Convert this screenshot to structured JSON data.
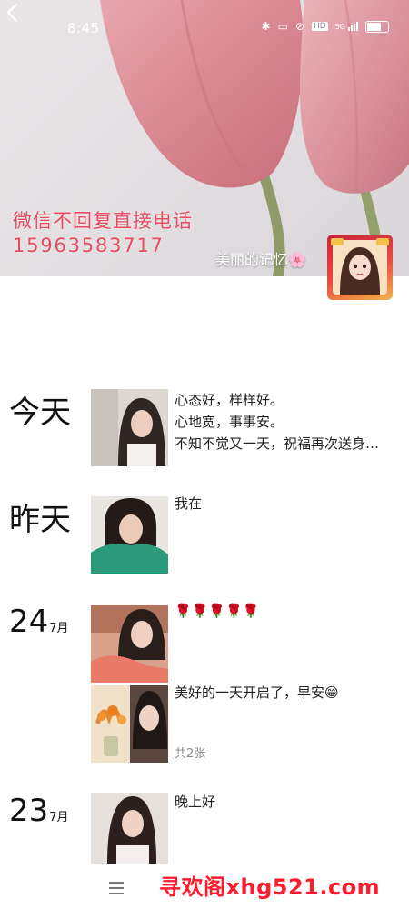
{
  "status_bar": {
    "time": "8:45",
    "network": "5G",
    "hd": "HD"
  },
  "cover": {
    "line1": "微信不回复直接电话",
    "line2": "15963583717",
    "username": "美丽的记忆🌸"
  },
  "feed": [
    {
      "date_word": "今天",
      "text": "心态好，样样好。\n心地宽，事事安。\n不知不觉又一天，祝福再次送身…"
    },
    {
      "date_word": "昨天",
      "text": "我在"
    },
    {
      "date_num": "24",
      "date_month": "7月",
      "posts": [
        {
          "text": "🌹🌹🌹🌹🌹"
        },
        {
          "text": "美好的一天开启了，早安😁",
          "count": "共2张"
        }
      ]
    },
    {
      "date_num": "23",
      "date_month": "7月",
      "text": "晚上好"
    }
  ],
  "watermark": "寻欢阁xhg521.com",
  "colors": {
    "cover_text": "#e84b5f",
    "watermark": "#ff1b2d"
  },
  "icons": [
    "back-arrow",
    "bluetooth",
    "vibrate",
    "hd",
    "signal",
    "battery",
    "menu"
  ]
}
